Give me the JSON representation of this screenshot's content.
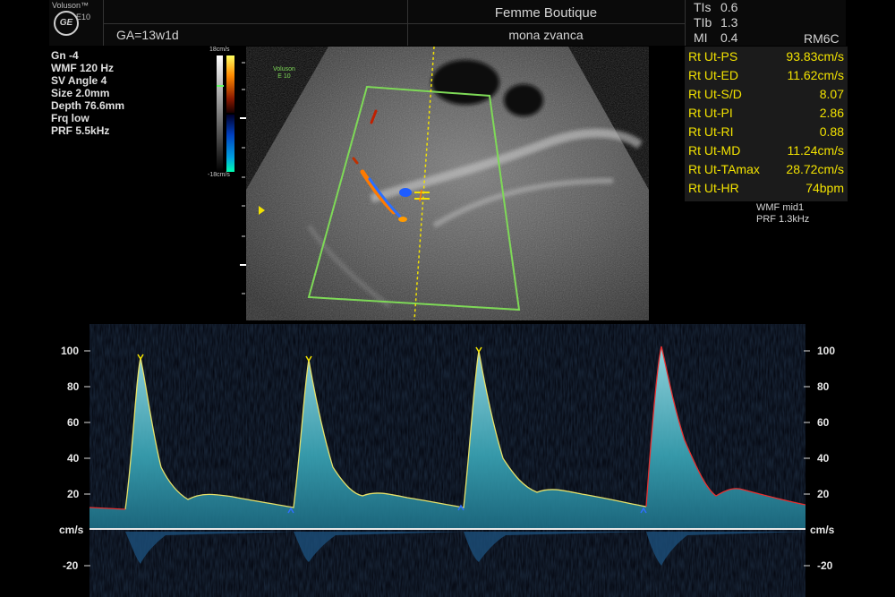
{
  "header": {
    "brand": "Voluson™",
    "model": "E10",
    "logo_text": "GE",
    "ga": "GA=13w1d",
    "clinic": "Femme Boutique",
    "patient": "mona zvanca",
    "safety": [
      {
        "label": "TIs",
        "value": "0.6"
      },
      {
        "label": "TIb",
        "value": "1.3"
      },
      {
        "label": "MI",
        "value": "0.4"
      }
    ],
    "probe": "RM6C"
  },
  "params": [
    "Gn  -4",
    "WMF 120 Hz",
    "SV Angle  4",
    "Size  2.0mm",
    "Depth 76.6mm",
    "Frq low",
    "PRF  5.5kHz"
  ],
  "color_scale": {
    "top": "18cm/s",
    "bottom": "-18cm/s"
  },
  "image_badge": {
    "line1": "Voluson",
    "line2": "E 10"
  },
  "measurements": [
    {
      "label": "Rt Ut-PS",
      "value": "93.83cm/s"
    },
    {
      "label": "Rt Ut-ED",
      "value": "11.62cm/s"
    },
    {
      "label": "Rt Ut-S/D",
      "value": "8.07"
    },
    {
      "label": "Rt Ut-PI",
      "value": "2.86"
    },
    {
      "label": "Rt Ut-RI",
      "value": "0.88"
    },
    {
      "label": "Rt Ut-MD",
      "value": "11.24cm/s"
    },
    {
      "label": "Rt Ut-TAmax",
      "value": "28.72cm/s"
    },
    {
      "label": "Rt Ut-HR",
      "value": "74bpm"
    }
  ],
  "doppler_settings": [
    "WMF mid1",
    "PRF  1.3kHz"
  ],
  "spectral": {
    "y_ticks_left": [
      "100",
      "80",
      "60",
      "40",
      "20",
      "cm/s",
      "-20"
    ],
    "y_ticks_right": [
      "100",
      "80",
      "60",
      "40",
      "20",
      "cm/s",
      "-20"
    ],
    "unit": "cm/s"
  },
  "colors": {
    "measure_text": "#f2e200",
    "doppler_fill": "#3aa7b8",
    "roi": "#7ed957"
  }
}
